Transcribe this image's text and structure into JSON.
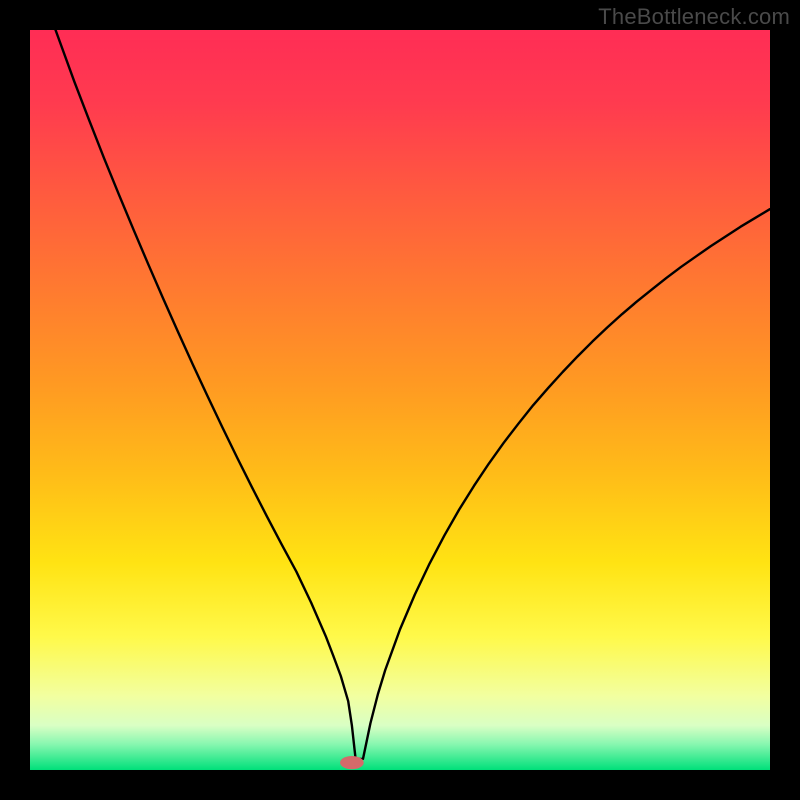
{
  "watermark": "TheBottleneck.com",
  "colors": {
    "frame": "#000000",
    "curve": "#000000",
    "marker": "#d46a6a",
    "gradient_stops": [
      {
        "offset": 0.0,
        "color": "#ff2d55"
      },
      {
        "offset": 0.1,
        "color": "#ff3b4f"
      },
      {
        "offset": 0.22,
        "color": "#ff5a3f"
      },
      {
        "offset": 0.35,
        "color": "#ff7a30"
      },
      {
        "offset": 0.48,
        "color": "#ff9a22"
      },
      {
        "offset": 0.6,
        "color": "#ffbc18"
      },
      {
        "offset": 0.72,
        "color": "#ffe313"
      },
      {
        "offset": 0.82,
        "color": "#fff94a"
      },
      {
        "offset": 0.9,
        "color": "#f2ffa0"
      },
      {
        "offset": 0.94,
        "color": "#d9ffc4"
      },
      {
        "offset": 0.965,
        "color": "#88f7b0"
      },
      {
        "offset": 1.0,
        "color": "#00e07a"
      }
    ]
  },
  "chart_data": {
    "type": "line",
    "title": "",
    "xlabel": "",
    "ylabel": "",
    "xlim": [
      0,
      100
    ],
    "ylim": [
      0,
      100
    ],
    "grid": false,
    "legend": false,
    "series": [
      {
        "name": "curve",
        "x": [
          0,
          2,
          4,
          6,
          8,
          10,
          12,
          14,
          16,
          18,
          20,
          22,
          24,
          26,
          28,
          30,
          32,
          34,
          36,
          38,
          40,
          41,
          42,
          43,
          43.5,
          44,
          45,
          46,
          47,
          48,
          50,
          52,
          54,
          56,
          58,
          60,
          62,
          64,
          66,
          68,
          70,
          72,
          74,
          76,
          78,
          80,
          82,
          84,
          86,
          88,
          90,
          92,
          94,
          96,
          98,
          100
        ],
        "y": [
          110,
          104,
          98.5,
          93,
          87.8,
          82.7,
          77.8,
          73,
          68.3,
          63.7,
          59.2,
          54.8,
          50.5,
          46.3,
          42.2,
          38.2,
          34.3,
          30.5,
          26.8,
          22.6,
          18,
          15.4,
          12.7,
          9.3,
          6.0,
          1.5,
          1.5,
          6.3,
          10.2,
          13.5,
          19.0,
          23.7,
          27.9,
          31.7,
          35.2,
          38.4,
          41.4,
          44.2,
          46.8,
          49.3,
          51.6,
          53.8,
          55.9,
          57.9,
          59.8,
          61.6,
          63.3,
          64.9,
          66.5,
          68.0,
          69.4,
          70.8,
          72.1,
          73.4,
          74.6,
          75.8
        ]
      }
    ],
    "marker": {
      "x": 43.5,
      "y": 1.0,
      "rx": 1.6,
      "ry": 0.9
    }
  }
}
